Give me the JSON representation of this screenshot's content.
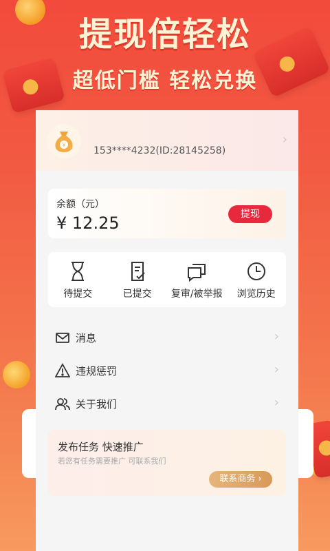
{
  "hero": {
    "title": "提现倍轻松",
    "subtitle": "超低门槛 轻松兑换"
  },
  "profile": {
    "phone_id": "153****4232(ID:28145258)"
  },
  "balance": {
    "label": "余额（元）",
    "amount": "¥ 12.25",
    "withdraw_label": "提现"
  },
  "actions": [
    {
      "label": "待提交",
      "icon": "hourglass-icon"
    },
    {
      "label": "已提交",
      "icon": "document-check-icon"
    },
    {
      "label": "复审/被举报",
      "icon": "chat-bubbles-icon"
    },
    {
      "label": "浏览历史",
      "icon": "clock-icon"
    }
  ],
  "menu": [
    {
      "label": "消息",
      "icon": "mail-icon"
    },
    {
      "label": "违规惩罚",
      "icon": "warning-icon"
    },
    {
      "label": "关于我们",
      "icon": "people-icon"
    }
  ],
  "promo": {
    "title": "发布任务 快速推广",
    "subtitle": "若您有任务需要推广 可联系我们",
    "button_label": "联系商务"
  },
  "colors": {
    "accent_red": "#e8283c",
    "background_red": "#f24a3c",
    "gold": "#d79a58"
  }
}
